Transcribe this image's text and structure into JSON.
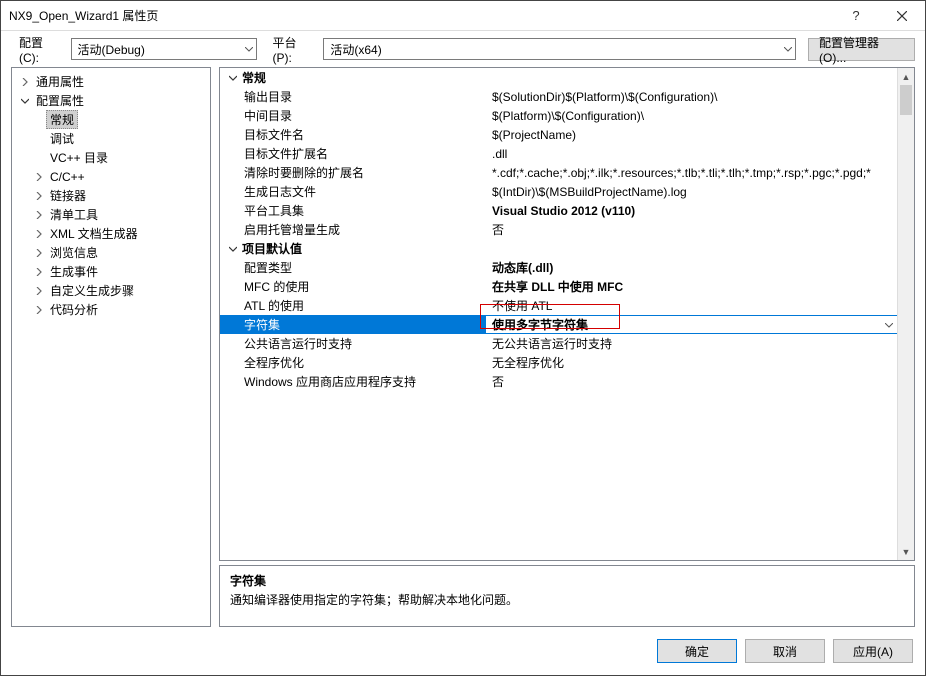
{
  "window": {
    "title": "NX9_Open_Wizard1 属性页",
    "help": "?",
    "close": "✕"
  },
  "toolbar": {
    "config_label": "配置(C):",
    "config_value": "活动(Debug)",
    "platform_label": "平台(P):",
    "platform_value": "活动(x64)",
    "config_mgr_label": "配置管理器(O)..."
  },
  "tree": {
    "nodes": [
      {
        "label": "通用属性",
        "level": 1,
        "expander": "›"
      },
      {
        "label": "配置属性",
        "level": 1,
        "expander": "⌄",
        "children": [
          {
            "label": "常规",
            "level": 2,
            "selected": true
          },
          {
            "label": "调试",
            "level": 2
          },
          {
            "label": "VC++ 目录",
            "level": 2
          },
          {
            "label": "C/C++",
            "level": 2,
            "expander": "›"
          },
          {
            "label": "链接器",
            "level": 2,
            "expander": "›"
          },
          {
            "label": "清单工具",
            "level": 2,
            "expander": "›"
          },
          {
            "label": "XML 文档生成器",
            "level": 2,
            "expander": "›"
          },
          {
            "label": "浏览信息",
            "level": 2,
            "expander": "›"
          },
          {
            "label": "生成事件",
            "level": 2,
            "expander": "›"
          },
          {
            "label": "自定义生成步骤",
            "level": 2,
            "expander": "›"
          },
          {
            "label": "代码分析",
            "level": 2,
            "expander": "›"
          }
        ]
      }
    ]
  },
  "properties": {
    "categories": [
      {
        "name": "常规",
        "rows": [
          {
            "name": "输出目录",
            "value": "$(SolutionDir)$(Platform)\\$(Configuration)\\"
          },
          {
            "name": "中间目录",
            "value": "$(Platform)\\$(Configuration)\\"
          },
          {
            "name": "目标文件名",
            "value": "$(ProjectName)"
          },
          {
            "name": "目标文件扩展名",
            "value": ".dll"
          },
          {
            "name": "清除时要删除的扩展名",
            "value": "*.cdf;*.cache;*.obj;*.ilk;*.resources;*.tlb;*.tli;*.tlh;*.tmp;*.rsp;*.pgc;*.pgd;*"
          },
          {
            "name": "生成日志文件",
            "value": "$(IntDir)\\$(MSBuildProjectName).log"
          },
          {
            "name": "平台工具集",
            "value": "Visual Studio 2012 (v110)",
            "bold": true
          },
          {
            "name": "启用托管增量生成",
            "value": "否"
          }
        ]
      },
      {
        "name": "项目默认值",
        "rows": [
          {
            "name": "配置类型",
            "value": "动态库(.dll)",
            "bold": true
          },
          {
            "name": "MFC 的使用",
            "value": "在共享 DLL 中使用 MFC",
            "bold": true
          },
          {
            "name": "ATL 的使用",
            "value": "不使用 ATL"
          },
          {
            "name": "字符集",
            "value": "使用多字节字符集",
            "selected": true,
            "highlighted": true
          },
          {
            "name": "公共语言运行时支持",
            "value": "无公共语言运行时支持"
          },
          {
            "name": "全程序优化",
            "value": "无全程序优化"
          },
          {
            "name": "Windows 应用商店应用程序支持",
            "value": "否"
          }
        ]
      }
    ]
  },
  "description": {
    "title": "字符集",
    "text": "通知编译器使用指定的字符集；帮助解决本地化问题。"
  },
  "buttons": {
    "ok": "确定",
    "cancel": "取消",
    "apply": "应用(A)"
  }
}
